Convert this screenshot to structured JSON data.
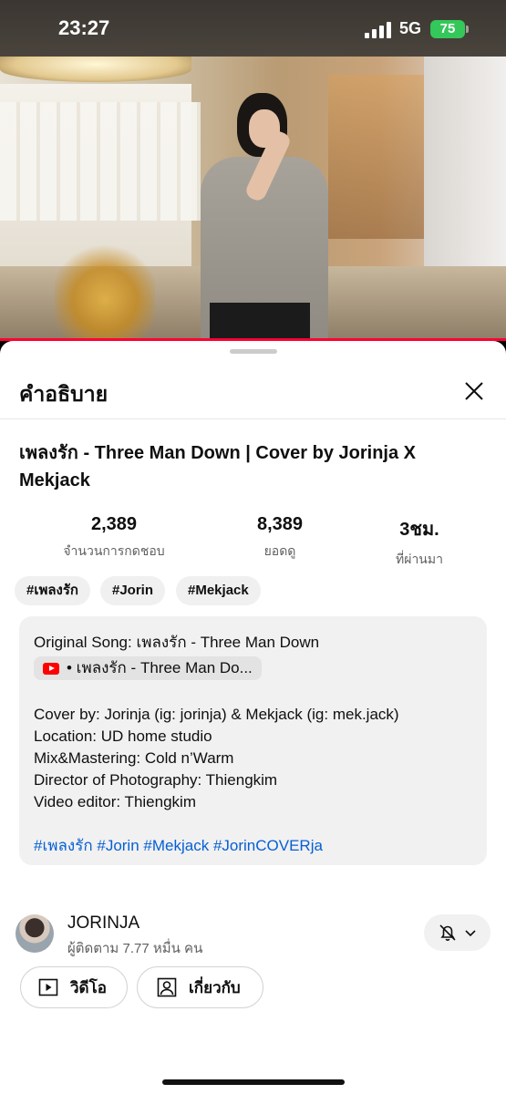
{
  "status_bar": {
    "time": "23:27",
    "network": "5G",
    "battery": "75"
  },
  "sheet": {
    "title": "คำอธิบาย"
  },
  "video": {
    "title": "เพลงรัก - Three Man Down | Cover by Jorinja X Mekjack"
  },
  "stats": [
    {
      "value": "2,389",
      "label": "จำนวนการกดชอบ"
    },
    {
      "value": "8,389",
      "label": "ยอดดู"
    },
    {
      "value": "3ชม.",
      "label": "ที่ผ่านมา"
    }
  ],
  "tags": [
    "#เพลงรัก",
    "#Jorin",
    "#Mekjack"
  ],
  "description": {
    "original_song": "Original Song: เพลงรัก - Three Man Down",
    "song_chip": "• เพลงรัก - Three Man Do...",
    "lines": [
      "Cover by: Jorinja (ig: jorinja) & Mekjack (ig: mek.jack)",
      "Location: UD home studio",
      "Mix&Mastering: Cold n’Warm",
      "Director of Photography: Thiengkim",
      "Video editor: Thiengkim"
    ],
    "hashtags": [
      "#เพลงรัก",
      "#Jorin",
      "#Mekjack",
      "#JorinCOVERja"
    ]
  },
  "channel": {
    "name": "JORINJA",
    "subscribers": "ผู้ติดตาม 7.77 หมื่น คน"
  },
  "buttons": {
    "videos": "วิดีโอ",
    "about": "เกี่ยวกับ"
  },
  "colors": {
    "accent": "#ff0033",
    "link": "#065fd4",
    "battery": "#34c759"
  },
  "icons": [
    "signal-icon",
    "battery-icon",
    "close-icon",
    "youtube-icon",
    "bell-off-icon",
    "chevron-down-icon",
    "play-box-icon",
    "person-box-icon"
  ]
}
